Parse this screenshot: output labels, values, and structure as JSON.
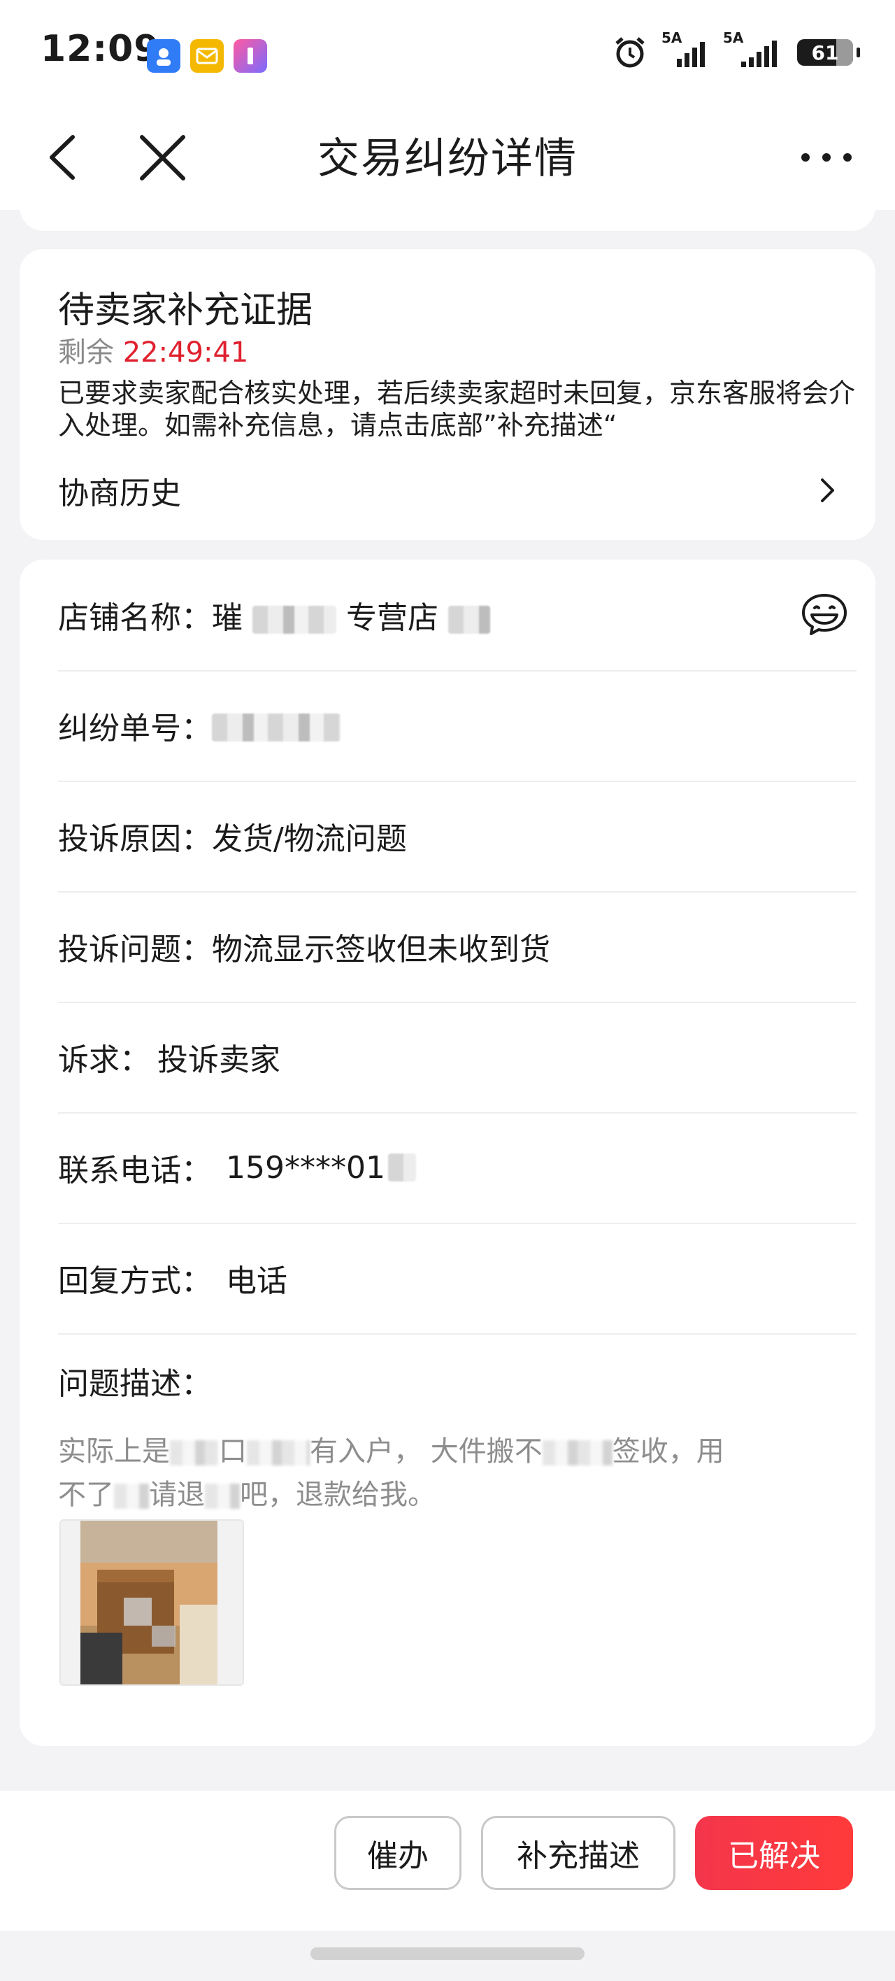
{
  "status_bar": {
    "time": "12:09",
    "signal_1_label": "5A",
    "signal_2_label": "5A",
    "battery_level": "61"
  },
  "nav": {
    "title": "交易纠纷详情"
  },
  "status_card": {
    "title": "待卖家补充证据",
    "remaining_prefix": "剩余",
    "countdown": "22:49:41",
    "description": "已要求卖家配合核实处理，若后续卖家超时未回复，京东客服将会介入处理。如需补充信息，请点击底部”补充描述“",
    "history_label": "协商历史"
  },
  "info": {
    "store_name_label": "店铺名称：",
    "store_name_value_a": "璀",
    "store_name_value_b": "专营店",
    "dispute_no_label": "纠纷单号：",
    "dispute_no_value": "",
    "complaint_reason_label": "投诉原因：",
    "complaint_reason_value": "发货/物流问题",
    "complaint_issue_label": "投诉问题：",
    "complaint_issue_value": "物流显示签收但未收到货",
    "appeal_label": "诉求：",
    "appeal_value": "投诉卖家",
    "phone_label": "联系电话：",
    "phone_value": "159****01",
    "reply_method_label": "回复方式：",
    "reply_method_value": "电话",
    "desc_label": "问题描述：",
    "desc_part_1": "实际上是",
    "desc_part_2": "口",
    "desc_part_3": "有入户，",
    "desc_part_4": "大件搬不",
    "desc_part_5": "签收，用",
    "desc_part_6": "不了",
    "desc_part_7": "请退",
    "desc_part_8": "吧，退款给我。"
  },
  "actions": {
    "urge": "催办",
    "supplement": "补充描述",
    "resolved": "已解决"
  },
  "colors": {
    "accent_red": "#e0202e",
    "button_red": "#f4364c",
    "background": "#f3f3f6"
  },
  "icons": [
    "back-icon",
    "close-icon",
    "more-icon",
    "chevron-right-icon",
    "chat-icon"
  ]
}
